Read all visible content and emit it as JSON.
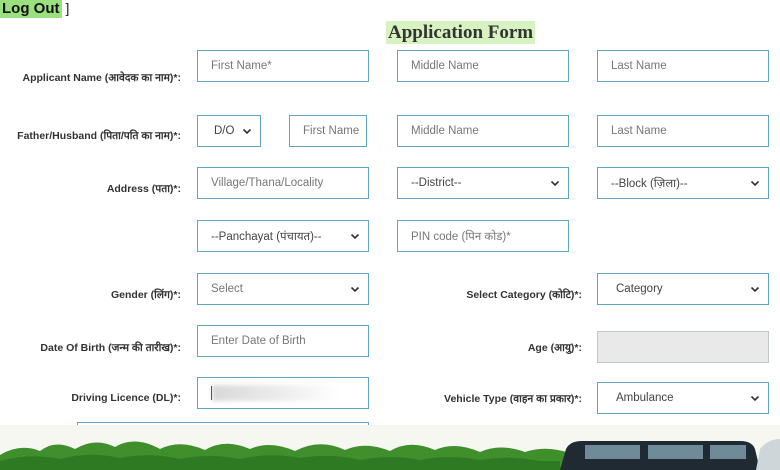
{
  "header": {
    "logout_label": "Log Out",
    "bracket": "]",
    "form_title": "Application Form"
  },
  "rows": {
    "applicant": {
      "label": "Applicant Name (आवेदक का नाम)*:",
      "first": "First Name*",
      "middle": "Middle Name",
      "last": "Last Name"
    },
    "father": {
      "label": "Father/Husband (पिता/पति का नाम)*:",
      "relation": "D/O",
      "first": "First Name",
      "middle": "Middle Name",
      "last": "Last Name"
    },
    "address": {
      "label": "Address (पता)*:",
      "locality": "Village/Thana/Locality",
      "district": "--District--",
      "block": "--Block (ज़िला)--",
      "panchayat": "--Panchayat (पंचायत)--",
      "pin": "PIN code (पिन कोड)*"
    },
    "gender": {
      "label": "Gender (लिंग)*:",
      "value": "Select"
    },
    "category": {
      "label": "Select Category (कोटि)*:",
      "value": "Category"
    },
    "dob": {
      "label": "Date Of Birth (जन्म की तारीख)*:",
      "placeholder": "Enter Date of Birth"
    },
    "age": {
      "label": "Age (आयु)*:"
    },
    "dl": {
      "label": "Driving Licence (DL)*:"
    },
    "vehicle": {
      "label": "Vehicle Type (वाहन का प्रकार)*:",
      "value": "Ambulance"
    }
  },
  "colors": {
    "field_border": "#5ea7c4",
    "title_highlight": "#d8f3c2",
    "logout_bg": "#9be07f",
    "grass": "#3f8f2c"
  },
  "icons": [
    "chevron-down-icon"
  ]
}
